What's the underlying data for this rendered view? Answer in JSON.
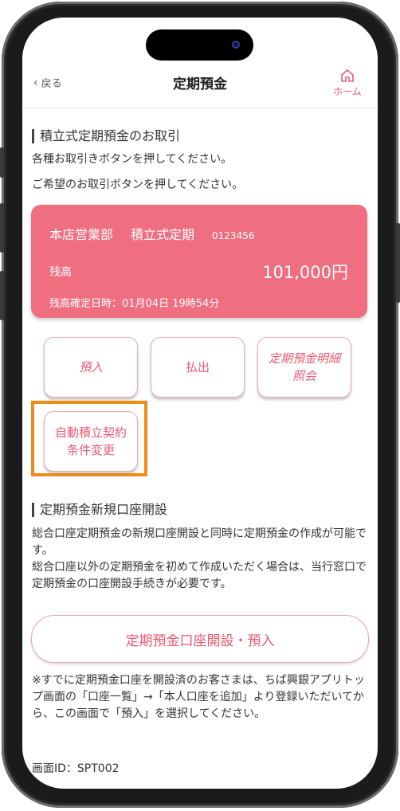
{
  "header": {
    "back_label": "戻る",
    "title": "定期預金",
    "home_label": "ホーム"
  },
  "section1": {
    "heading": "積立式定期預金のお取引",
    "line1": "各種お取引きボタンを押してください。",
    "line2": "ご希望のお取引ボタンを押してください。"
  },
  "account_card": {
    "branch": "本店営業部",
    "type": "積立式定期",
    "account_number": "0123456",
    "balance_label": "残高",
    "balance_value": "101,000円",
    "confirmed_date": "残高確定日時：01月04日 19時54分"
  },
  "actions": {
    "deposit": "預入",
    "withdraw": "払出",
    "statement_line1": "定期預金明細",
    "statement_line2": "照会",
    "auto_line1": "自動積立契約",
    "auto_line2": "条件変更"
  },
  "section2": {
    "heading": "定期預金新規口座開設",
    "para1": "総合口座定期預金の新規口座開設と同時に定期預金の作成が可能です。",
    "para2": "総合口座以外の定期預金を初めて作成いただく場合は、当行窓口で定期預金の口座開設手続きが必要です。",
    "open_button": "定期預金口座開設・預入"
  },
  "note": "※すでに定期預金口座を開設済のお客さまは、ちば興銀アプリトップ画面の「口座一覧」→「本人口座を追加」より登録いただいてから、この画面で「預入」を選択してください。",
  "screen_id": "画面ID：SPT002",
  "colors": {
    "accent": "#e85a72",
    "card": "#ef6f81",
    "highlight": "#f08a19"
  }
}
